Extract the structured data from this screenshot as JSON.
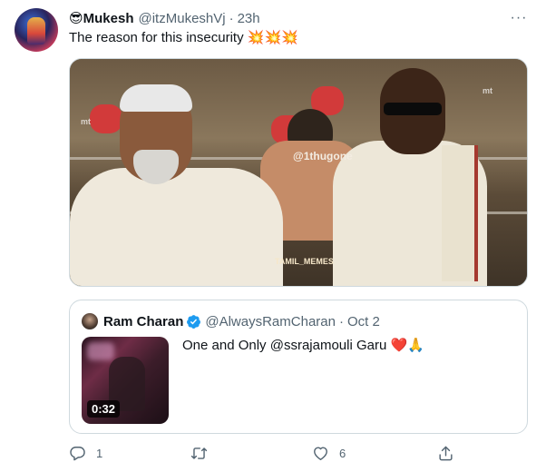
{
  "tweet": {
    "author_name": "Mukesh",
    "author_emoji": "😎",
    "handle": "@itzMukeshVj",
    "separator": "·",
    "time": "23h",
    "more_label": "···",
    "text": "The reason for this insecurity",
    "text_emojis": "💥💥💥",
    "media": {
      "watermark": "@1thugone",
      "mark_left": "mt",
      "mark_right": "mt",
      "app_mark": "TAMIL_MEMES"
    }
  },
  "quote": {
    "author_name": "Ram Charan",
    "handle": "@AlwaysRamCharan",
    "separator": "·",
    "date": "Oct 2",
    "text": "One and Only @ssrajamouli Garu",
    "text_emojis": "❤️🙏",
    "video_duration": "0:32"
  },
  "actions": {
    "reply_count": "1",
    "retweet_count": "",
    "like_count": "6",
    "share_count": ""
  },
  "colors": {
    "text_primary": "#0f1419",
    "text_secondary": "#536471",
    "border": "#cfd9de",
    "verified": "#1d9bf0"
  },
  "icons": {
    "reply": "reply-icon",
    "retweet": "retweet-icon",
    "like": "heart-icon",
    "share": "share-icon",
    "more": "more-icon",
    "verified": "verified-badge-icon"
  }
}
